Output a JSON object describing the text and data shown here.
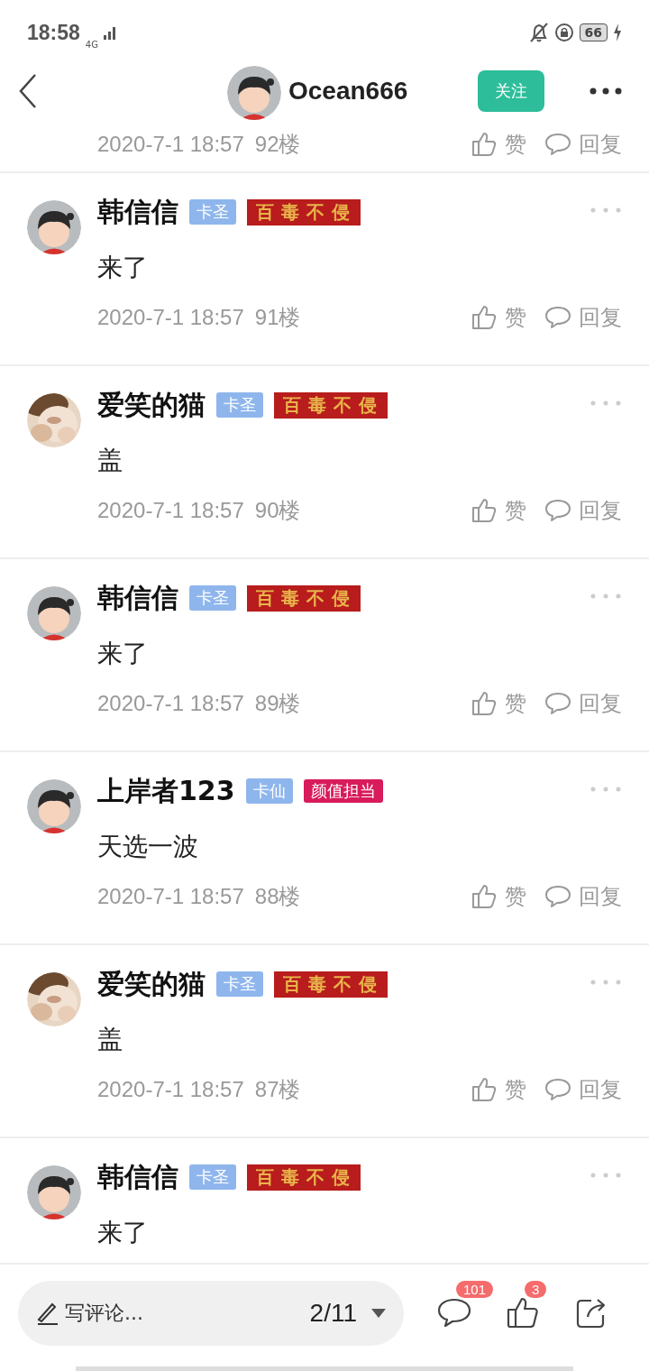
{
  "status_bar": {
    "time": "18:58",
    "network": "4G",
    "battery": "66"
  },
  "header": {
    "username": "Ocean666",
    "follow_button": "关注"
  },
  "partial_post": {
    "time": "2020-7-1 18:57",
    "floor": "92楼",
    "like": "赞",
    "reply": "回复"
  },
  "posts": [
    {
      "avatar": {
        "kind": "cartoon"
      },
      "name": "韩信信",
      "level": "卡圣",
      "title": {
        "kind": "calligraphy",
        "text": "百毒不侵"
      },
      "content": "来了",
      "time": "2020-7-1 18:57",
      "floor": "91楼",
      "like": "赞",
      "reply": "回复"
    },
    {
      "name": "爱笑的猫",
      "level": "卡圣",
      "title": {
        "kind": "calligraphy",
        "text": "百毒不侵"
      },
      "content": "盖",
      "time": "2020-7-1 18:57",
      "floor": "90楼",
      "like": "赞",
      "reply": "回复"
    },
    {
      "avatar": {
        "kind": "cartoon"
      },
      "name": "韩信信",
      "level": "卡圣",
      "title": {
        "kind": "calligraphy",
        "text": "百毒不侵"
      },
      "content": "来了",
      "time": "2020-7-1 18:57",
      "floor": "89楼",
      "like": "赞",
      "reply": "回复"
    },
    {
      "avatar": {
        "kind": "cartoon"
      },
      "name": "上岸者123",
      "level": "卡仙",
      "title": {
        "kind": "plain",
        "text": "颜值担当"
      },
      "content": "天选一波",
      "time": "2020-7-1 18:57",
      "floor": "88楼",
      "like": "赞",
      "reply": "回复"
    },
    {
      "name": "爱笑的猫",
      "level": "卡圣",
      "title": {
        "kind": "calligraphy",
        "text": "百毒不侵"
      },
      "content": "盖",
      "time": "2020-7-1 18:57",
      "floor": "87楼",
      "like": "赞",
      "reply": "回复"
    },
    {
      "avatar": {
        "kind": "cartoon"
      },
      "name": "韩信信",
      "level": "卡圣",
      "title": {
        "kind": "calligraphy",
        "text": "百毒不侵"
      },
      "content": "来了"
    }
  ],
  "bottom_bar": {
    "placeholder": "写评论...",
    "page": "2/11",
    "comment_count": "101",
    "like_count": "3"
  }
}
